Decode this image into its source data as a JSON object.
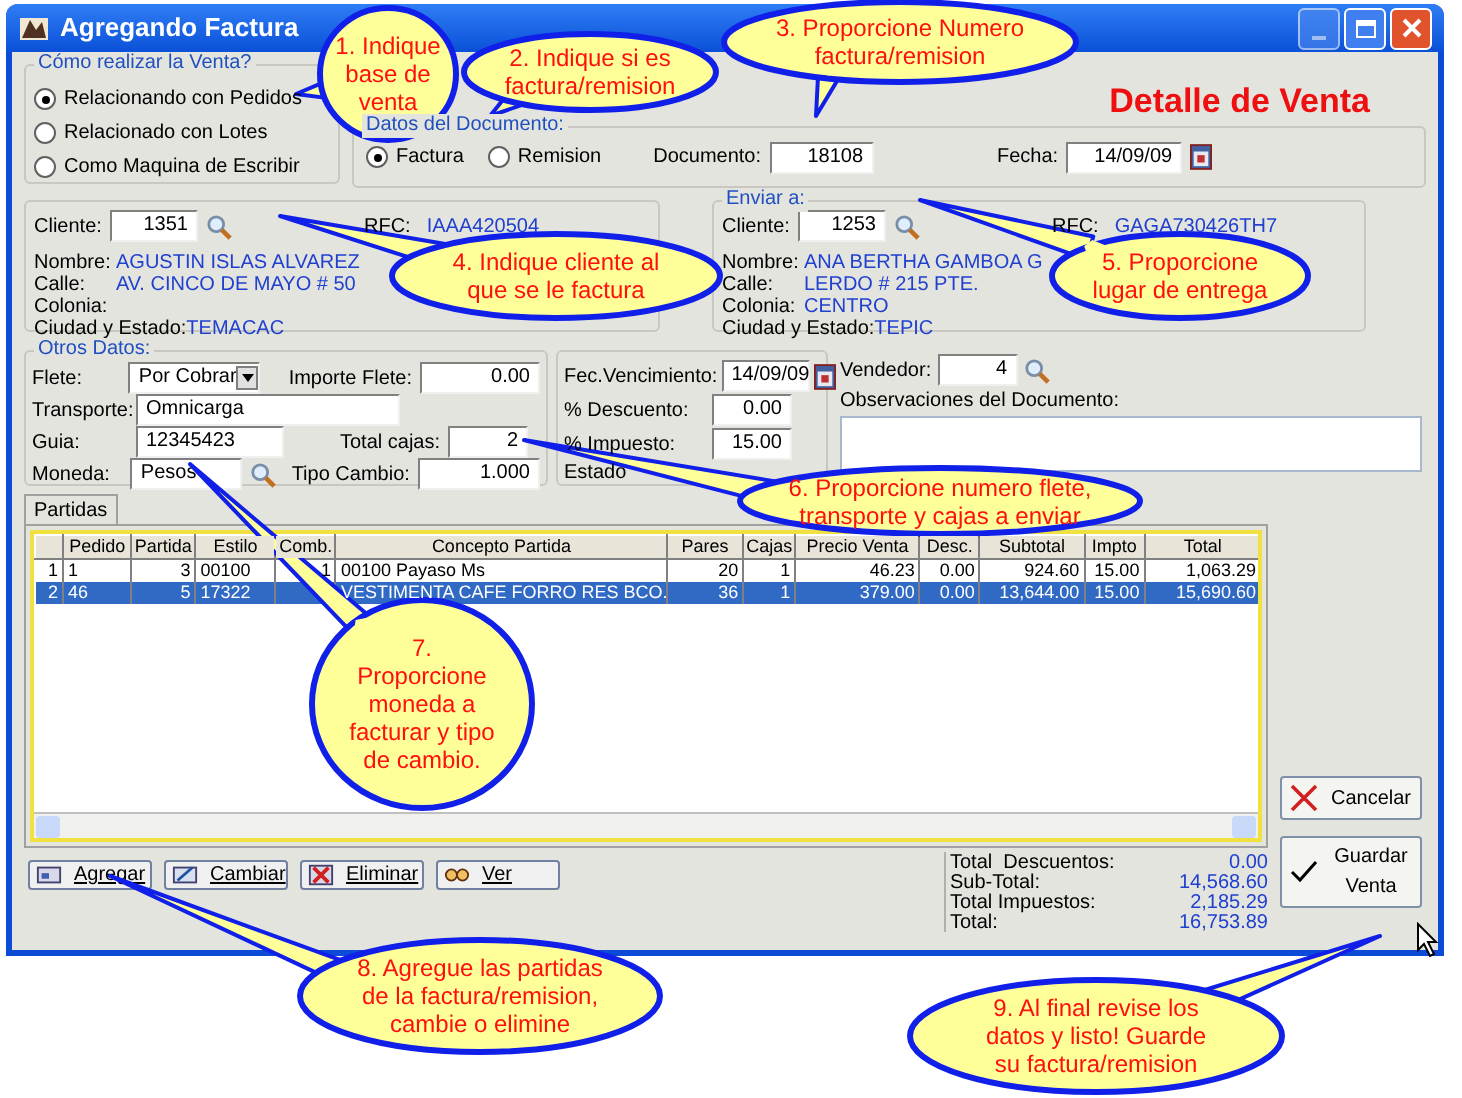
{
  "window": {
    "title": "Agregando Factura"
  },
  "heading": "Detalle de Venta",
  "venta": {
    "legend": "Cómo realizar la Venta?",
    "options": [
      {
        "label": "Relacionando con Pedidos",
        "selected": true
      },
      {
        "label": "Relacionado con Lotes",
        "selected": false
      },
      {
        "label": "Como Maquina de Escribir",
        "selected": false
      }
    ]
  },
  "documento": {
    "legend": "Datos del Documento:",
    "types": [
      {
        "label": "Factura",
        "selected": true
      },
      {
        "label": "Remision",
        "selected": false
      }
    ],
    "numero": {
      "label": "Documento:",
      "value": "18108"
    },
    "fecha": {
      "label": "Fecha:",
      "value": "14/09/09"
    }
  },
  "cliente": {
    "label": "Cliente:",
    "value": "1351",
    "rfc_label": "RFC:",
    "rfc": "IAAA420504",
    "fields": [
      {
        "label": "Nombre:",
        "value": "AGUSTIN ISLAS ALVAREZ"
      },
      {
        "label": "Calle:",
        "value": "AV. CINCO DE MAYO # 50"
      },
      {
        "label": "Colonia:"
      },
      {
        "label": "Ciudad y Estado:",
        "value": "TEMACAC"
      }
    ]
  },
  "enviar": {
    "legend": "Enviar a:",
    "label": "Cliente:",
    "value": "1253",
    "rfc_label": "RFC:",
    "rfc": "GAGA730426TH7",
    "fields": [
      {
        "label": "Nombre:",
        "value": "ANA BERTHA GAMBOA G"
      },
      {
        "label": "Calle:",
        "value": "LERDO # 215 PTE."
      },
      {
        "label": "Colonia:",
        "value": "CENTRO"
      },
      {
        "label": "Ciudad y Estado:",
        "value": "TEPIC"
      }
    ]
  },
  "otros": {
    "legend": "Otros Datos:",
    "flete": {
      "label": "Flete:",
      "value": "Por Cobrar"
    },
    "importe_flete": {
      "label": "Importe Flete:",
      "value": "0.00"
    },
    "transporte": {
      "label": "Transporte:",
      "value": "Omnicarga"
    },
    "guia": {
      "label": "Guia:",
      "value": "12345423"
    },
    "total_cajas": {
      "label": "Total cajas:",
      "value": "2"
    },
    "moneda": {
      "label": "Moneda:",
      "value": "Pesos"
    },
    "tipo_cambio": {
      "label": "Tipo Cambio:",
      "value": "1.000"
    }
  },
  "fechas": {
    "vencimiento": {
      "label": "Fec.Vencimiento:",
      "value": "14/09/09"
    },
    "descuento": {
      "label": "% Descuento:",
      "value": "0.00"
    },
    "impuesto": {
      "label": "% Impuesto:",
      "value": "15.00"
    },
    "estado_label": "Estado"
  },
  "vendedor": {
    "label": "Vendedor:",
    "value": "4"
  },
  "observaciones": {
    "label": "Observaciones del Documento:"
  },
  "tabs": [
    {
      "label": "Partidas",
      "selected": true
    }
  ],
  "table": {
    "columns": [
      "",
      "Pedido",
      "Partida",
      "Estilo",
      "Comb.",
      "Concepto Partida",
      "Pares",
      "Cajas",
      "Precio Venta",
      "Desc.",
      "Subtotal",
      "Impto",
      "Total"
    ],
    "rows": [
      {
        "selected": false,
        "cells": [
          "1",
          "1",
          "3",
          "00100",
          "1",
          "00100 Payaso Ms",
          "20",
          "1",
          "46.23",
          "0.00",
          "924.60",
          "15.00",
          "1,063.29"
        ]
      },
      {
        "selected": true,
        "cells": [
          "2",
          "46",
          "5",
          "17322",
          "",
          "VESTIMENTA CAFE FORRO RES BCO.",
          "36",
          "1",
          "379.00",
          "0.00",
          "13,644.00",
          "15.00",
          "15,690.60"
        ]
      }
    ]
  },
  "actions": [
    "Agregar",
    "Cambiar",
    "Eliminar",
    "Ver"
  ],
  "totals": [
    {
      "label": "Total  Descuentos:",
      "value": "0.00"
    },
    {
      "label": "Sub-Total:",
      "value": "14,568.60"
    },
    {
      "label": "Total Impuestos:",
      "value": "2,185.29"
    },
    {
      "label": "Total:",
      "value": "16,753.89"
    }
  ],
  "side_buttons": [
    {
      "kind": "cancel",
      "label": "Cancelar"
    },
    {
      "kind": "save",
      "label": "Guardar\nVenta"
    }
  ],
  "callouts": [
    "1. Indique\nbase de\nventa",
    "2. Indique si es\nfactura/remision",
    "3. Proporcione Numero\nfactura/remision",
    "4. Indique cliente al\nque se le factura",
    "5. Proporcione\nlugar de entrega",
    "6. Proporcione numero flete,\ntransporte y cajas a enviar",
    "7.\nProporcione\nmoneda a\nfacturar y tipo\nde cambio.",
    "8. Agregue las partidas\nde la factura/remision,\ncambie o elimine",
    "9. Al final revise los\ndatos y listo! Guarde\nsu factura/remision"
  ]
}
